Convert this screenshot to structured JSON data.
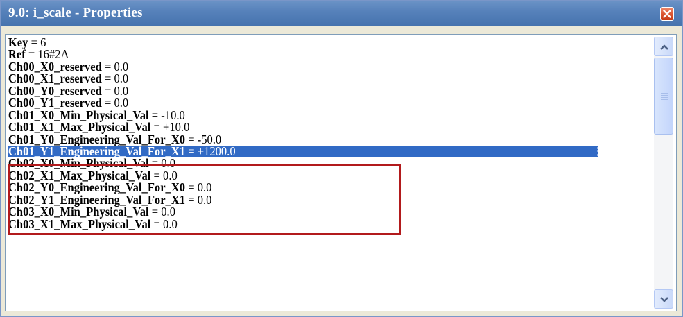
{
  "window": {
    "title": "9.0: i_scale - Properties"
  },
  "properties": [
    {
      "key": "Key",
      "value": "6"
    },
    {
      "key": "Ref",
      "value": "16#2A"
    },
    {
      "key": "Ch00_X0_reserved",
      "value": "0.0"
    },
    {
      "key": "Ch00_X1_reserved",
      "value": "0.0"
    },
    {
      "key": "Ch00_Y0_reserved",
      "value": "0.0"
    },
    {
      "key": "Ch00_Y1_reserved",
      "value": "0.0"
    },
    {
      "key": "Ch01_X0_Min_Physical_Val",
      "value": "-10.0"
    },
    {
      "key": "Ch01_X1_Max_Physical_Val",
      "value": "+10.0"
    },
    {
      "key": "Ch01_Y0_Engineering_Val_For_X0",
      "value": "-50.0"
    },
    {
      "key": "Ch01_Y1_Engineering_Val_For_X1",
      "value": "+1200.0"
    },
    {
      "key": "Ch02_X0_Min_Physical_Val",
      "value": "0.0"
    },
    {
      "key": "Ch02_X1_Max_Physical_Val",
      "value": "0.0"
    },
    {
      "key": "Ch02_Y0_Engineering_Val_For_X0",
      "value": "0.0"
    },
    {
      "key": "Ch02_Y1_Engineering_Val_For_X1",
      "value": "0.0"
    },
    {
      "key": "Ch03_X0_Min_Physical_Val",
      "value": "0.0"
    },
    {
      "key": "Ch03_X1_Max_Physical_Val",
      "value": "0.0"
    }
  ],
  "selected_index": 9,
  "separator": " = ",
  "colors": {
    "titlebar": "#5782bb",
    "selection": "#316ac5",
    "highlight_box": "#b21a1c",
    "close_button": "#d9532f"
  },
  "icons": {
    "close": "close-x-icon",
    "scroll_up": "chevron-up-icon",
    "scroll_down": "chevron-down-icon",
    "thumb_grip": "grip-lines-icon"
  }
}
